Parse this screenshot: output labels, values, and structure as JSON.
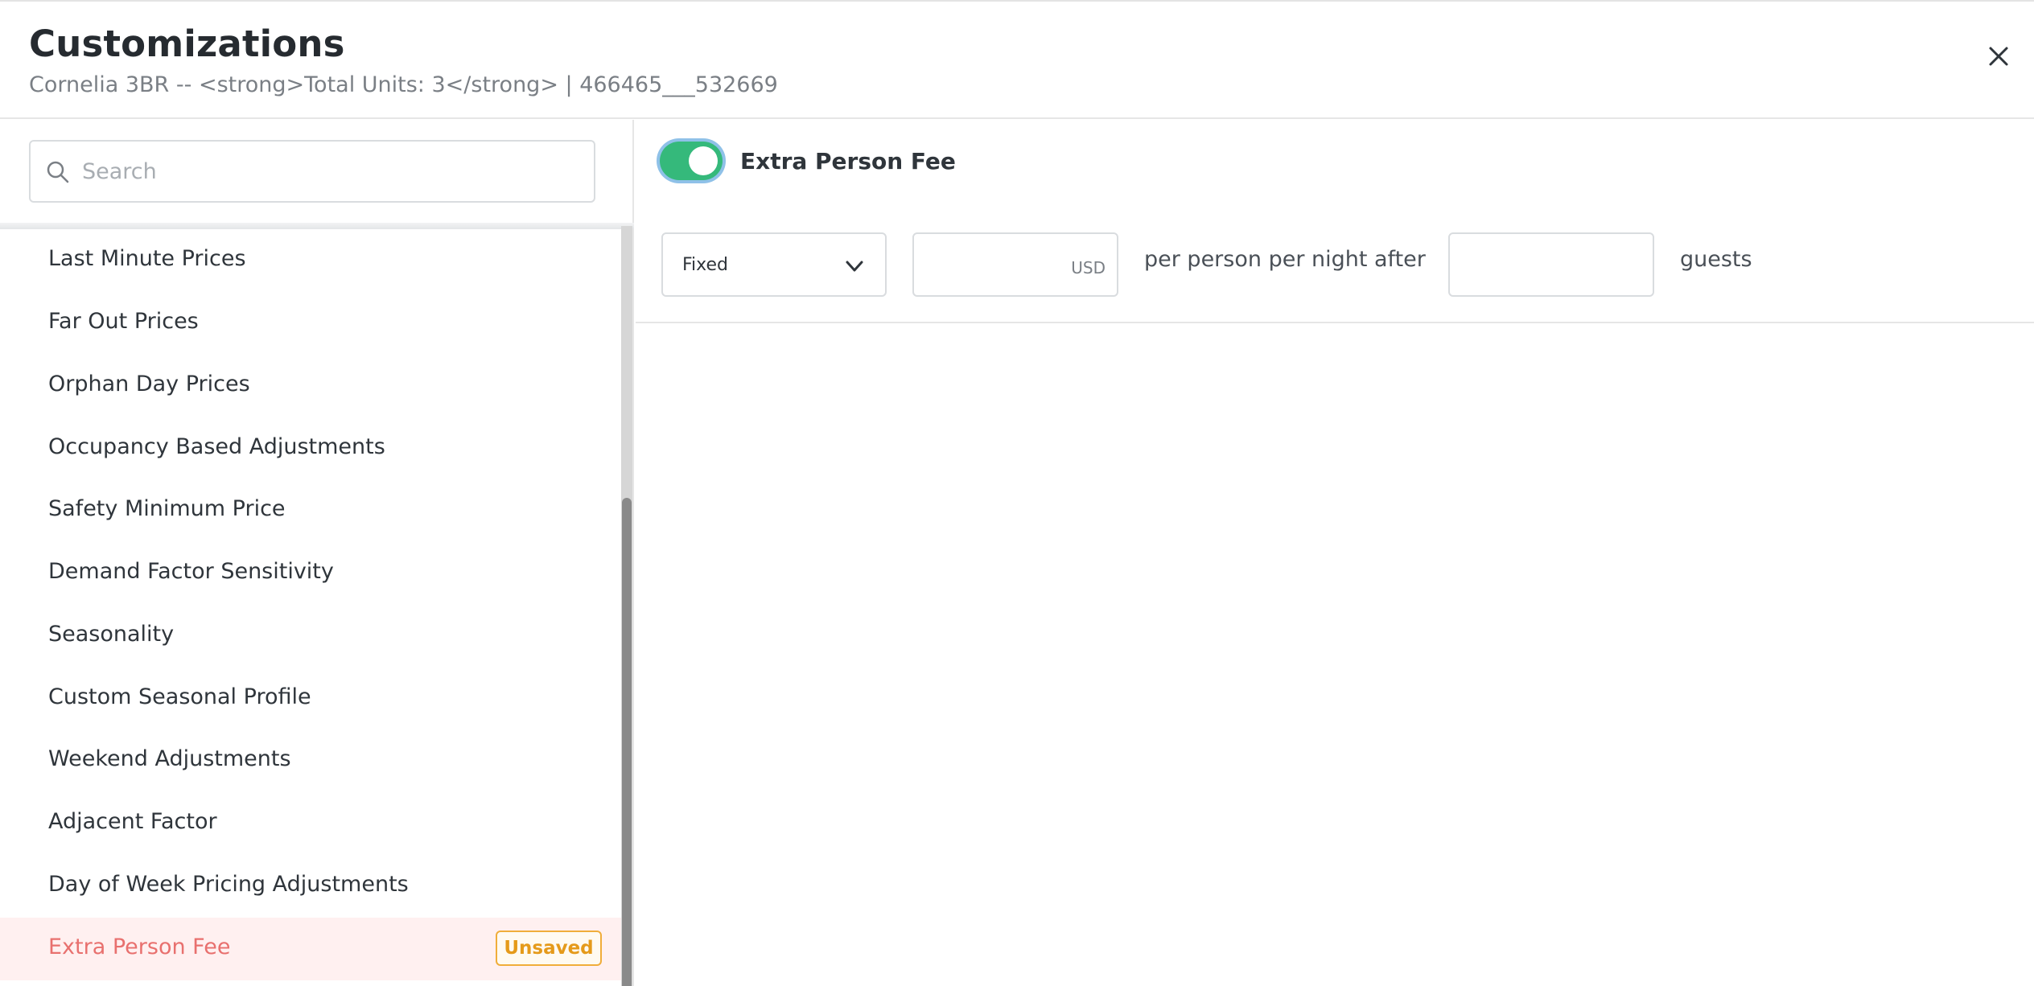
{
  "header": {
    "title": "Customizations",
    "subtitle": "Cornelia 3BR -- <strong>Total Units: 3</strong> | 466465___532669"
  },
  "search": {
    "placeholder": "Search",
    "value": ""
  },
  "sidebar": {
    "items": [
      {
        "label": "Last Minute Prices"
      },
      {
        "label": "Far Out Prices"
      },
      {
        "label": "Orphan Day Prices"
      },
      {
        "label": "Occupancy Based Adjustments"
      },
      {
        "label": "Safety Minimum Price"
      },
      {
        "label": "Demand Factor Sensitivity"
      },
      {
        "label": "Seasonality"
      },
      {
        "label": "Custom Seasonal Profile"
      },
      {
        "label": "Weekend Adjustments"
      },
      {
        "label": "Adjacent Factor"
      },
      {
        "label": "Day of Week Pricing Adjustments"
      },
      {
        "label": "Extra Person Fee",
        "active": true,
        "badge": "Unsaved"
      }
    ]
  },
  "panel": {
    "toggle_label": "Extra Person Fee",
    "toggle_on": true,
    "fee_type": "Fixed",
    "amount_value": "",
    "currency": "USD",
    "per_text": "per person per night",
    "after_text": "after",
    "guests_value": "",
    "guests_text": "guests"
  },
  "colors": {
    "toggle_on": "#35b97b",
    "active_text": "#e8706e",
    "active_bg": "#fff0f0",
    "badge": "#f0ad3a"
  }
}
